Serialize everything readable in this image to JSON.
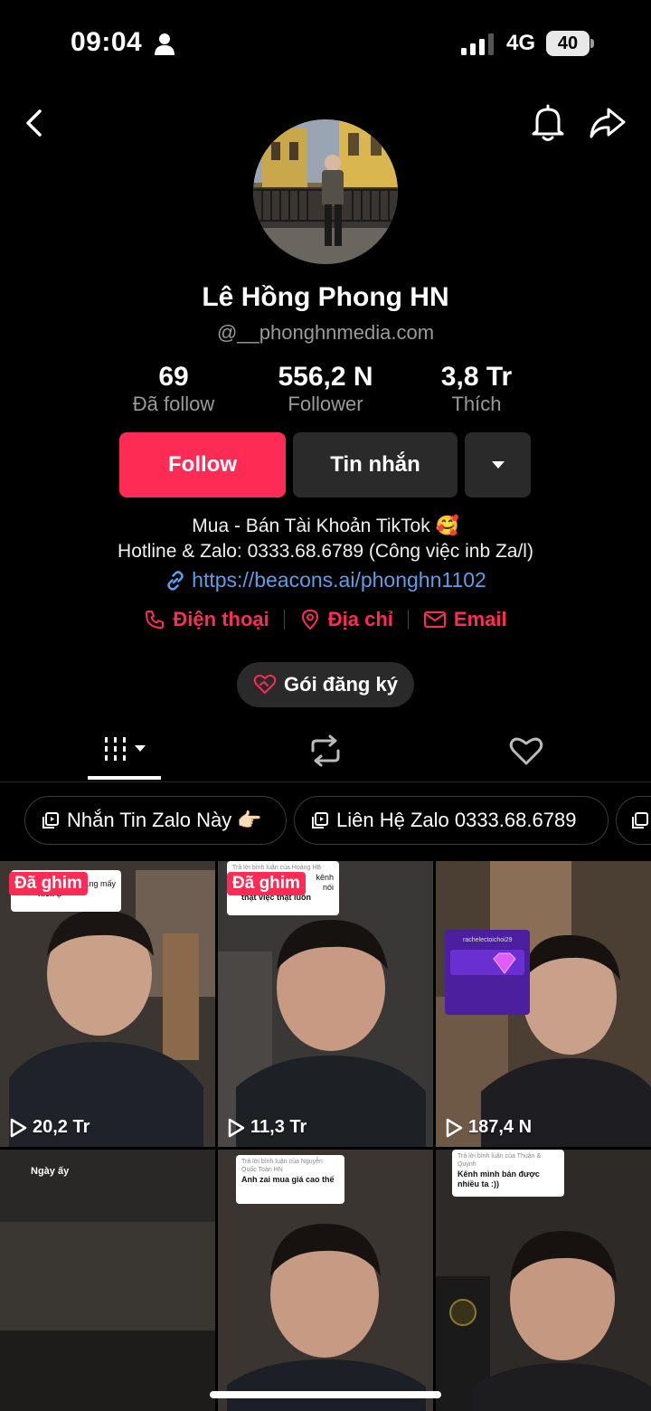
{
  "status_bar": {
    "time": "09:04",
    "network": "4G",
    "battery": "40"
  },
  "header": {
    "back_icon": "chevron-left-icon",
    "bell_icon": "bell-icon",
    "share_icon": "share-icon"
  },
  "profile": {
    "name": "Lê Hồng Phong HN",
    "handle": "@__phonghnmedia.com",
    "stats": [
      {
        "value": "69",
        "label": "Đã follow"
      },
      {
        "value": "556,2 N",
        "label": "Follower"
      },
      {
        "value": "3,8 Tr",
        "label": "Thích"
      }
    ],
    "buttons": {
      "follow": "Follow",
      "message": "Tin nhắn"
    },
    "bio_line1": "Mua - Bán Tài Khoản TikTok 🥰",
    "bio_line2": "Hotline & Zalo: 0333.68.6789 (Công việc inb Za/l)",
    "link": "https://beacons.ai/phonghn1102",
    "contacts": {
      "phone": "Điện thoại",
      "address": "Địa chỉ",
      "email": "Email"
    },
    "subscription": "Gói đăng ký"
  },
  "tabs": [
    "videos-tab",
    "reposts-tab",
    "liked-tab"
  ],
  "playlists": [
    {
      "label": "Nhắn Tin Zalo Này 👉🏻"
    },
    {
      "label": "Liên Hệ Zalo 0333.68.6789"
    }
  ],
  "videos": [
    {
      "pinned": "Đã ghim",
      "views": "20,2 Tr",
      "caption_lines": [
        "...ng mấy",
        "nick ạ"
      ]
    },
    {
      "pinned": "Đã ghim",
      "views": "11,3 Tr",
      "caption_lines": [
        "Trả lời bình luận của Hoàng HB",
        "kênh",
        "nói",
        "thật việc thật luôn"
      ]
    },
    {
      "views": "187,4 N",
      "card_user": "rachelectoichoi29"
    },
    {
      "caption": "Ngày ấy"
    },
    {
      "reply_header": "Trả lời bình luận của Nguyễn Quốc Toàn HN",
      "reply_text": "Anh zai mua giá cao thế"
    },
    {
      "reply_header": "Trả lời bình luận của Thuận & Quỳnh",
      "reply_text": "Kênh mình bán được nhiều ta :))"
    }
  ],
  "colors": {
    "accent": "#fe2c55",
    "link": "#5b9fe7",
    "background": "#000000",
    "button_dark": "#2a2a2a"
  }
}
